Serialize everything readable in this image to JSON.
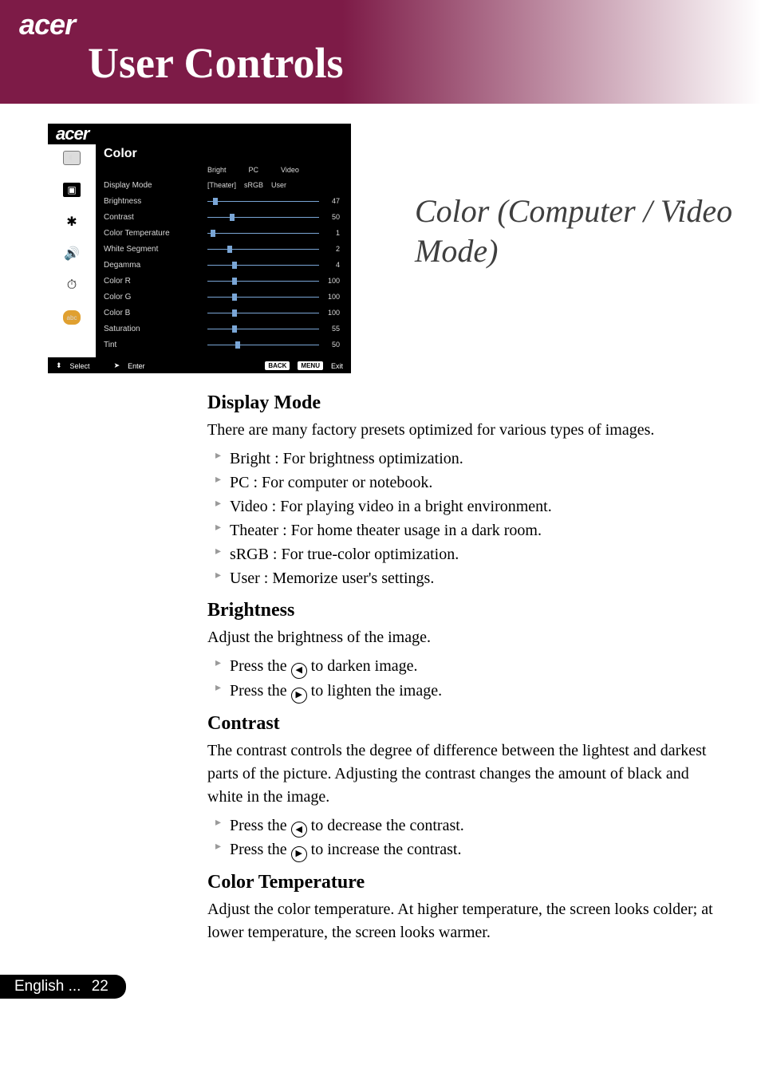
{
  "header": {
    "brand": "acer",
    "title": "User Controls"
  },
  "osd": {
    "brand": "acer",
    "title": "Color",
    "option_headers": [
      "Bright",
      "PC",
      "Video"
    ],
    "display_mode_row": {
      "label": "Display Mode",
      "options": [
        "[Theater]",
        "sRGB",
        "User"
      ]
    },
    "sliders": [
      {
        "label": "Brightness",
        "value": 47,
        "pos": 5
      },
      {
        "label": "Contrast",
        "value": 50,
        "pos": 20
      },
      {
        "label": "Color Temperature",
        "value": 1,
        "pos": 3
      },
      {
        "label": "White Segment",
        "value": 2,
        "pos": 18
      },
      {
        "label": "Degamma",
        "value": 4,
        "pos": 22
      },
      {
        "label": "Color R",
        "value": 100,
        "pos": 22
      },
      {
        "label": "Color G",
        "value": 100,
        "pos": 22
      },
      {
        "label": "Color B",
        "value": 100,
        "pos": 22
      },
      {
        "label": "Saturation",
        "value": 55,
        "pos": 22
      },
      {
        "label": "Tint",
        "value": 50,
        "pos": 25
      }
    ],
    "footer": {
      "select": "Select",
      "enter": "Enter",
      "back": "BACK",
      "menu": "MENU",
      "exit": "Exit"
    }
  },
  "side_heading": "Color (Computer / Video Mode)",
  "sections": {
    "display_mode": {
      "heading": "Display Mode",
      "intro": "There are many factory presets optimized for various types of images.",
      "items": [
        "Bright : For brightness optimization.",
        "PC : For computer or notebook.",
        "Video : For playing video in a bright environment.",
        "Theater : For home theater usage in a dark room.",
        "sRGB : For true-color optimization.",
        "User : Memorize user's settings."
      ]
    },
    "brightness": {
      "heading": "Brightness",
      "intro": "Adjust the brightness of the image.",
      "left_pre": "Press the ",
      "left_post": " to darken image.",
      "right_pre": "Press the ",
      "right_post": " to lighten the image."
    },
    "contrast": {
      "heading": "Contrast",
      "intro": "The contrast controls the degree of difference between the lightest and darkest parts of the picture. Adjusting the contrast changes the amount of black and white in the image.",
      "left_pre": "Press the ",
      "left_post": " to decrease the contrast.",
      "right_pre": "Press the ",
      "right_post": " to increase the contrast."
    },
    "color_temp": {
      "heading": "Color Temperature",
      "intro": "Adjust the color temperature. At higher temperature, the screen looks colder; at lower temperature, the screen looks warmer."
    }
  },
  "footer": {
    "lang": "English ...",
    "page": "22"
  }
}
